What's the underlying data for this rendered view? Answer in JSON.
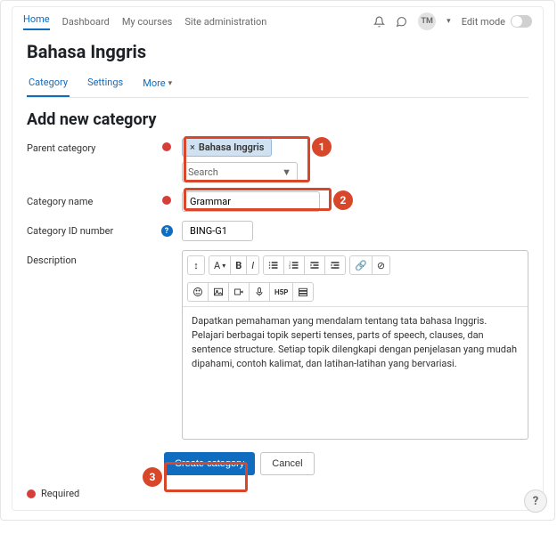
{
  "topnav": {
    "items": [
      "Home",
      "Dashboard",
      "My courses",
      "Site administration"
    ],
    "active_index": 0
  },
  "header": {
    "avatar_initials": "TM",
    "edit_mode_label": "Edit mode"
  },
  "page_title": "Bahasa Inggris",
  "subtabs": {
    "items": [
      "Category",
      "Settings",
      "More"
    ],
    "active_index": 0
  },
  "section_title": "Add new category",
  "form": {
    "parent_category": {
      "label": "Parent category",
      "tag_remove": "×",
      "tag_value": "Bahasa Inggris",
      "search_placeholder": "Search"
    },
    "category_name": {
      "label": "Category name",
      "value": "Grammar"
    },
    "category_id": {
      "label": "Category ID number",
      "value": "BING-G1"
    },
    "description": {
      "label": "Description",
      "value": "Dapatkan pemahaman yang mendalam tentang tata bahasa Inggris. Pelajari berbagai topik seperti tenses, parts of speech, clauses, dan sentence structure. Setiap topik dilengkapi dengan penjelasan yang mudah dipahami, contoh kalimat, dan latihan-latihan yang bervariasi."
    }
  },
  "toolbar": {
    "expand": "↕",
    "font_dropdown": "A",
    "bold": "B",
    "italic": "I",
    "link": "🔗",
    "unlink": "⊘",
    "h5p": "H5P"
  },
  "buttons": {
    "create": "Create category",
    "cancel": "Cancel"
  },
  "required_note": "Required",
  "annotations": {
    "n1": "1",
    "n2": "2",
    "n3": "3"
  }
}
